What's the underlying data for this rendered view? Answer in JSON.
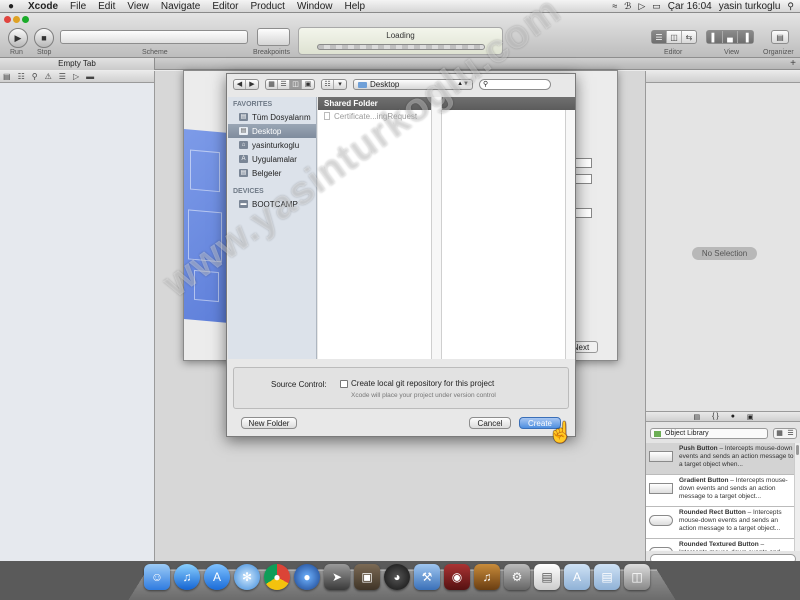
{
  "menubar": {
    "app_name": "Xcode",
    "items": [
      "File",
      "Edit",
      "View",
      "Navigate",
      "Editor",
      "Product",
      "Window",
      "Help"
    ],
    "clock": "Çar 16:04",
    "user": "yasin turkoglu"
  },
  "toolbar": {
    "run_label": "Run",
    "stop_label": "Stop",
    "scheme_label": "Scheme",
    "breakpoints_label": "Breakpoints",
    "activity_text": "Loading",
    "editor_label": "Editor",
    "view_label": "View",
    "organizer_label": "Organizer"
  },
  "tabbar": {
    "tab_label": "Empty Tab"
  },
  "inspector": {
    "no_selection": "No Selection"
  },
  "library": {
    "selector": "Object Library",
    "items": [
      {
        "title": "Push Button",
        "desc": " – Intercepts mouse-down events and sends an action message to a target object when..."
      },
      {
        "title": "Gradient Button",
        "desc": " – Intercepts mouse-down events and sends an action message to a target object..."
      },
      {
        "title": "Rounded Rect Button",
        "desc": " – Intercepts mouse-down events and sends an action message to a target object..."
      },
      {
        "title": "Rounded Textured Button",
        "desc": " – Intercepts mouse-down events and se..."
      }
    ]
  },
  "back_sheet": {
    "next_label": "Next"
  },
  "save_sheet": {
    "location": "Desktop",
    "sidebar": {
      "favorites_header": "FAVORITES",
      "favorites": [
        "Tüm Dosyalarım",
        "Desktop",
        "yasinturkoglu",
        "Uygulamalar",
        "Belgeler"
      ],
      "selected_index": 1,
      "devices_header": "DEVICES",
      "devices": [
        "BOOTCAMP"
      ]
    },
    "browser": {
      "selected_folder": "Shared Folder",
      "file": "Certificate...ingRequest"
    },
    "source_control": {
      "label": "Source Control:",
      "checkbox_label": "Create local git repository for this project",
      "note": "Xcode will place your project under version control",
      "checked": false
    },
    "new_folder_label": "New Folder",
    "cancel_label": "Cancel",
    "create_label": "Create"
  },
  "dock": {
    "icons": [
      "finder-icon",
      "itunes-icon",
      "app-store-icon",
      "safari-icon",
      "chrome-icon",
      "google-earth-icon",
      "launchpad-icon",
      "image-capture-icon",
      "dashboard-icon",
      "xcode-icon",
      "photo-booth-icon",
      "garageband-icon",
      "system-preferences-icon",
      "preview-icon",
      "applications-folder-icon",
      "documents-folder-icon",
      "trash-icon"
    ]
  },
  "watermark": "www.yasinturkoglu.com",
  "colors": {
    "accent": "#4f8fe0",
    "sidebar_selection": "#7f8c9d"
  }
}
